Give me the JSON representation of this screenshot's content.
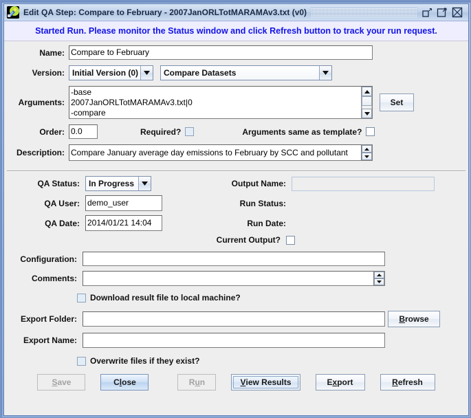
{
  "window": {
    "title": "Edit QA Step: Compare to February - 2007JanORLTotMARAMAv3.txt (v0)",
    "icon": "app-icon",
    "minimize_label": "Minimize",
    "maximize_label": "Maximize",
    "close_label": "Close"
  },
  "banner": {
    "message": "Started Run. Please monitor the Status window and click Refresh button to track your run request.",
    "color": "#1414e6",
    "background": "#eeeeff"
  },
  "form": {
    "name": {
      "label": "Name:",
      "value": "Compare to February"
    },
    "version": {
      "label": "Version:",
      "value": "Initial Version (0)",
      "options": [
        "Initial Version (0)"
      ]
    },
    "program": {
      "value": "Compare Datasets",
      "options": [
        "Compare Datasets"
      ]
    },
    "arguments": {
      "label": "Arguments:",
      "value": "-base\n2007JanORLTotMARAMAv3.txt|0\n-compare",
      "lines": [
        "-base",
        "2007JanORLTotMARAMAv3.txt|0",
        "-compare"
      ],
      "set_button": "Set"
    },
    "order": {
      "label": "Order:",
      "value": "0.0"
    },
    "required": {
      "label": "Required?",
      "checked": false
    },
    "args_same_as_template": {
      "label": "Arguments same as template?",
      "checked": false
    },
    "description": {
      "label": "Description:",
      "value": "Compare January average day emissions to February by SCC and pollutant"
    }
  },
  "qa": {
    "status": {
      "label": "QA Status:",
      "value": "In Progress",
      "options": [
        "In Progress"
      ]
    },
    "user": {
      "label": "QA User:",
      "value": "demo_user"
    },
    "date": {
      "label": "QA Date:",
      "value": "2014/01/21 14:04"
    },
    "output_name": {
      "label": "Output Name:",
      "value": "",
      "enabled": false
    },
    "run_status": {
      "label": "Run Status:",
      "value": ""
    },
    "run_date": {
      "label": "Run Date:",
      "value": ""
    },
    "current_output": {
      "label": "Current Output?",
      "checked": false
    },
    "configuration": {
      "label": "Configuration:",
      "value": ""
    },
    "comments": {
      "label": "Comments:",
      "value": ""
    },
    "download_result": {
      "label": "Download result file to local machine?",
      "checked": false
    },
    "export_folder": {
      "label": "Export Folder:",
      "value": "",
      "browse_button": "Browse"
    },
    "export_name": {
      "label": "Export Name:",
      "value": ""
    },
    "overwrite": {
      "label": "Overwrite files if they exist?",
      "checked": false
    }
  },
  "buttons": {
    "save": {
      "label": "Save",
      "enabled": false
    },
    "close": {
      "label": "Close",
      "enabled": true
    },
    "run": {
      "label": "Run",
      "enabled": false
    },
    "view_results": {
      "label": "View Results",
      "enabled": true,
      "focused": true
    },
    "export": {
      "label": "Export",
      "enabled": true
    },
    "refresh": {
      "label": "Refresh",
      "enabled": true
    }
  }
}
